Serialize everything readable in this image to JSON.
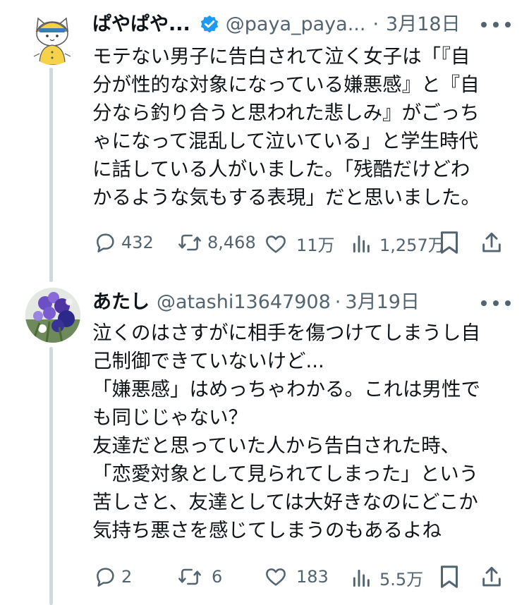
{
  "tweets": [
    {
      "display_name": "ぱやぱや...",
      "handle": "@paya_paya...",
      "separator": "·",
      "date": "3月18日",
      "verified": true,
      "text": "モテない男子に告白されて泣く女子は「『自\n分が性的な対象になっている嫌悪感』と『自\n分なら釣り合うと思われた悲しみ』がごっち\nゃになって混乱して泣いている」と学生時代\nに話している人がいました。「残酷だけどわ\nかるような気もする表現」だと思いました。",
      "replies": "432",
      "retweets": "8,468",
      "likes": "11万",
      "views": "1,257万"
    },
    {
      "display_name": "あたし",
      "handle": "@atashi13647908",
      "separator": "·",
      "date": "3月19日",
      "verified": false,
      "text": "泣くのはさすがに相手を傷つけてしまうし自\n己制御できていないけど...\n「嫌悪感」はめっちゃわかる。これは男性で\nも同じじゃない？\n友達だと思っていた人から告白された時、\n「恋愛対象として見られてしまった」という\n苦しさと、友達としては大好きなのにどこか\n気持ち悪さを感じてしまうのもあるよね",
      "replies": "2",
      "retweets": "6",
      "likes": "183",
      "views": "5.5万"
    }
  ],
  "colors": {
    "verified_badge": "#1d9bf0",
    "secondary_text": "#536471",
    "thread_line": "#cfd9de"
  },
  "icons": {
    "reply": "speech-bubble-icon",
    "retweet": "retweet-icon",
    "like": "heart-icon",
    "views": "bar-chart-icon",
    "bookmark": "bookmark-icon",
    "share": "share-icon",
    "more": "more-horizontal-icon"
  }
}
